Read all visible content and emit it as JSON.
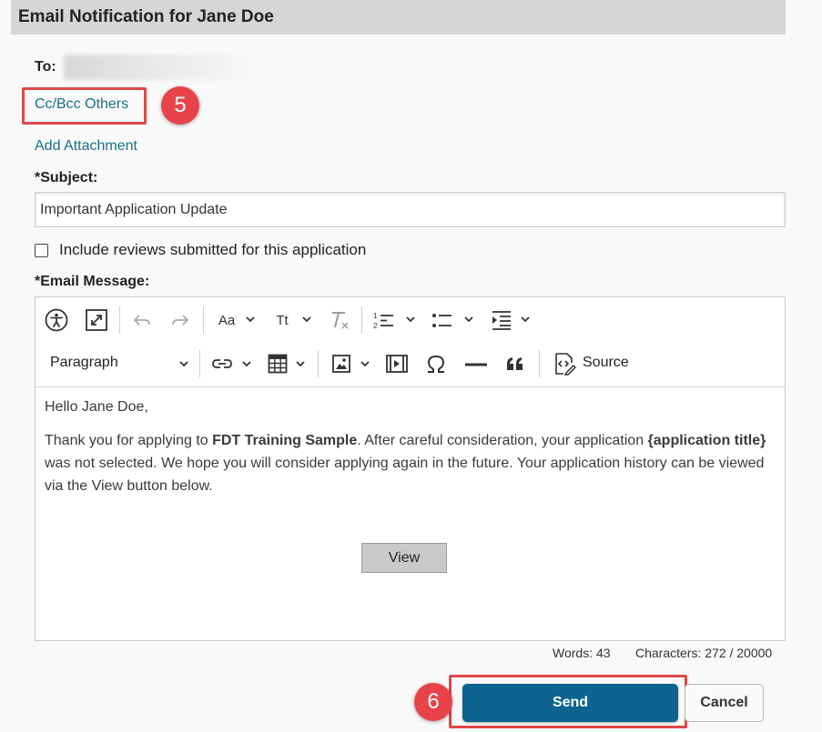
{
  "header": {
    "title": "Email Notification for Jane Doe"
  },
  "recipient": {
    "to_label": "To:"
  },
  "links": {
    "cc_bcc": "Cc/Bcc Others",
    "add_attachment": "Add Attachment"
  },
  "callouts": {
    "step5": "5",
    "step6": "6"
  },
  "subject": {
    "label": "*Subject:",
    "value": "Important Application Update"
  },
  "include_reviews": {
    "label": "Include reviews submitted for this application",
    "checked": false
  },
  "message": {
    "label": "*Email Message:",
    "greeting": "Hello Jane Doe,",
    "body_part1": "Thank you for applying to ",
    "body_bold1": "FDT Training Sample",
    "body_part2": ". After careful consideration, your application ",
    "body_bold2": "{application title}",
    "body_part3": " was not selected. We hope you will consider applying again in the future. Your application history can be viewed via the View button below.",
    "view_button": "View"
  },
  "toolbar": {
    "heading_select": "Paragraph",
    "font_size_label": "Aa",
    "text_transform_label": "Tt",
    "source_label": "Source",
    "icons": [
      "accessibility-icon",
      "fullscreen-icon",
      "undo-icon",
      "redo-icon",
      "font-size-icon",
      "text-transform-icon",
      "remove-format-icon",
      "numbered-list-icon",
      "bulleted-list-icon",
      "indent-icon",
      "link-icon",
      "table-icon",
      "image-icon",
      "media-icon",
      "special-char-icon",
      "horizontal-line-icon",
      "blockquote-icon",
      "source-icon"
    ]
  },
  "counter": {
    "words": "Words: 43",
    "characters": "Characters: 272 / 20000"
  },
  "actions": {
    "send": "Send",
    "cancel": "Cancel"
  },
  "colors": {
    "link": "#1a6e8a",
    "send": "#0e648f",
    "callout": "#e04848",
    "header_bg": "#d6d6d6"
  }
}
